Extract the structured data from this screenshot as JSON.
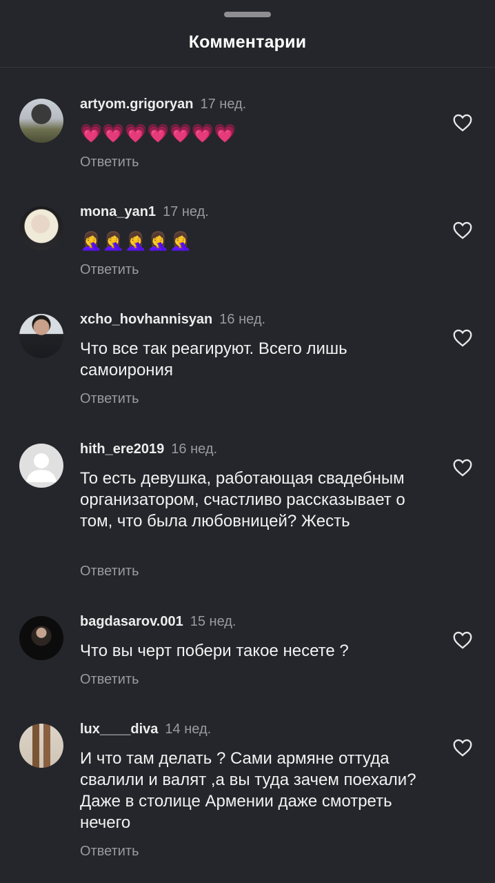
{
  "sheet": {
    "title": "Комментарии"
  },
  "comments": [
    {
      "username": "artyom.grigoryan",
      "time": "17 нед.",
      "emoji": "💗💗💗💗💗💗💗",
      "text": "",
      "reply_label": "Ответить"
    },
    {
      "username": "mona_yan1",
      "time": "17 нед.",
      "emoji": "🤦‍♀️🤦‍♀️🤦‍♀️🤦‍♀️🤦‍♀️",
      "text": "",
      "reply_label": "Ответить"
    },
    {
      "username": "xcho_hovhannisyan",
      "time": "16 нед.",
      "text": "Что все так реагируют. Всего лишь самоирония",
      "reply_label": "Ответить"
    },
    {
      "username": "hith_ere2019",
      "time": "16 нед.",
      "text": "То есть девушка, работающая свадебным организатором, счастливо рассказывает о том, что была любовницей? Жесть",
      "reply_label": "Ответить"
    },
    {
      "username": "bagdasarov.001",
      "time": "15 нед.",
      "text": "Что вы черт побери такое несете ?",
      "reply_label": "Ответить"
    },
    {
      "username": "lux____diva",
      "time": "14 нед.",
      "text": "И что там делать ? Сами армяне оттуда свалили и валят ,а вы туда зачем поехали? Даже в столице Армении даже смотреть нечего",
      "reply_label": "Ответить"
    }
  ],
  "icons": {
    "like": "heart-outline-icon",
    "handle": "drag-handle"
  },
  "colors": {
    "background": "#25262b",
    "secondary_text": "#9a9a9f",
    "primary_text": "#f2f2f2"
  }
}
